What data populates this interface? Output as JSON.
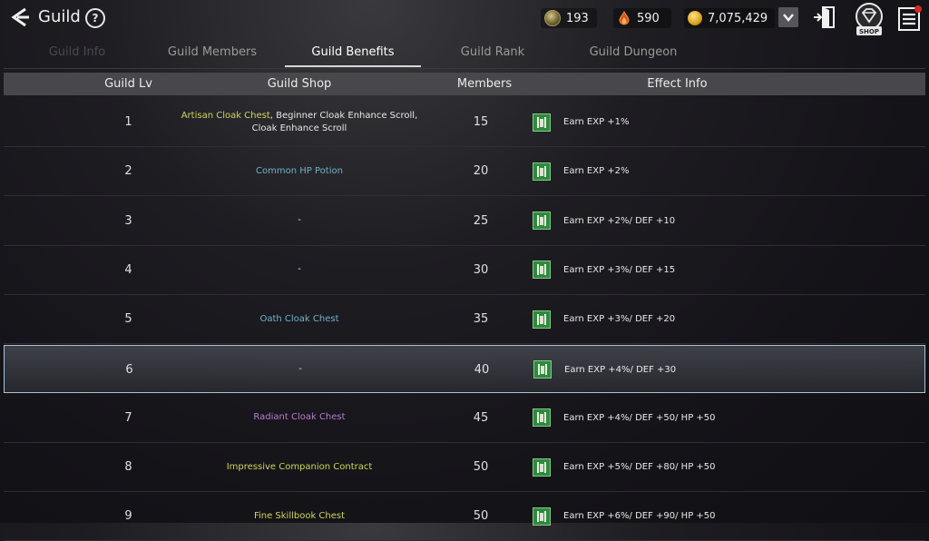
{
  "header": {
    "title": "Guild",
    "help_label": "?",
    "currency1": "193",
    "currency2": "590",
    "gold": "7,075,429",
    "shop_label": "SHOP"
  },
  "tabs": [
    {
      "label": "Guild Info",
      "active": false
    },
    {
      "label": "Guild Members",
      "active": false
    },
    {
      "label": "Guild Benefits",
      "active": true
    },
    {
      "label": "Guild Rank",
      "active": false
    },
    {
      "label": "Guild Dungeon",
      "active": false
    }
  ],
  "table": {
    "columns": [
      "Guild Lv",
      "Guild Shop",
      "Members",
      "Effect Info"
    ],
    "rows": [
      {
        "lv": "1",
        "shop_parts": [
          {
            "text": "Artisan Cloak Chest",
            "color": "yellow"
          },
          {
            "text": ", Beginner Cloak Enhance Scroll,",
            "color": "white"
          },
          {
            "text": "Cloak Enhance Scroll",
            "color": "white"
          }
        ],
        "members": "15",
        "effect": "Earn EXP +1%"
      },
      {
        "lv": "2",
        "shop_parts": [
          {
            "text": "Common HP Potion",
            "color": "blue"
          }
        ],
        "members": "20",
        "effect": "Earn EXP +2%"
      },
      {
        "lv": "3",
        "shop_parts": [
          {
            "text": "-",
            "color": "white"
          }
        ],
        "members": "25",
        "effect": "Earn EXP +2%/ DEF +10"
      },
      {
        "lv": "4",
        "shop_parts": [
          {
            "text": "-",
            "color": "white"
          }
        ],
        "members": "30",
        "effect": "Earn EXP +3%/ DEF +15"
      },
      {
        "lv": "5",
        "shop_parts": [
          {
            "text": "Oath Cloak Chest",
            "color": "blue"
          }
        ],
        "members": "35",
        "effect": "Earn EXP +3%/ DEF +20"
      },
      {
        "lv": "6",
        "shop_parts": [
          {
            "text": "-",
            "color": "white"
          }
        ],
        "members": "40",
        "effect": "Earn EXP +4%/ DEF +30",
        "selected": true
      },
      {
        "lv": "7",
        "shop_parts": [
          {
            "text": "Radiant Cloak Chest",
            "color": "purple"
          }
        ],
        "members": "45",
        "effect": "Earn EXP +4%/ DEF +50/ HP +50"
      },
      {
        "lv": "8",
        "shop_parts": [
          {
            "text": "Impressive Companion Contract",
            "color": "yellow"
          }
        ],
        "members": "50",
        "effect": "Earn EXP +5%/ DEF +80/ HP +50"
      },
      {
        "lv": "9",
        "shop_parts": [
          {
            "text": "Fine Skillbook Chest",
            "color": "yellow"
          }
        ],
        "members": "50",
        "effect": "Earn EXP +6%/ DEF +90/ HP +50"
      }
    ]
  },
  "colors": {
    "yellow": "#cfd65a",
    "blue": "#6fb3c9",
    "purple": "#b77dd0",
    "selection_border": "#a8c4d6"
  },
  "icons": {
    "back": "back-arrow-icon",
    "help": "help-icon",
    "currency1": "crystal-coin-icon",
    "currency2": "flame-gem-icon",
    "gold": "gold-coin-icon",
    "dropdown": "chevron-down-icon",
    "exit": "exit-door-icon",
    "shop": "diamond-shop-icon",
    "menu": "hamburger-menu-icon",
    "buff": "guild-buff-icon"
  }
}
